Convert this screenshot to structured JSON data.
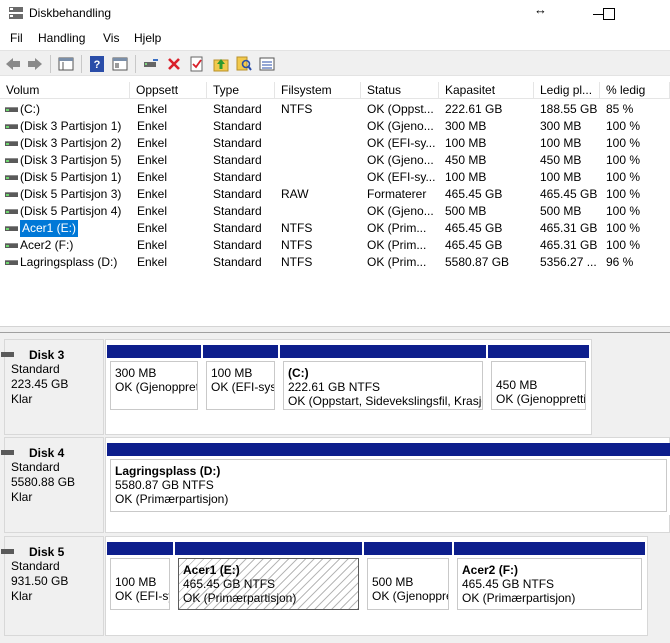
{
  "window": {
    "title": "Diskbehandling"
  },
  "menu": [
    "Fil",
    "Handling",
    "Vis",
    "Hjelp"
  ],
  "toolbar": {
    "icons": [
      "back-icon",
      "forward-icon",
      "properties-pane-icon",
      "help-icon",
      "console-icon",
      "connect-icon",
      "delete-icon",
      "check-icon",
      "folder-up-icon",
      "search-icon",
      "list-view-icon"
    ]
  },
  "colors": {
    "partition_bar": "#0d1e8c",
    "selection": "#0078d7"
  },
  "volume_list": {
    "headers": [
      "Volum",
      "Oppsett",
      "Type",
      "Filsystem",
      "Status",
      "Kapasitet",
      "Ledig pl...",
      "% ledig"
    ],
    "rows": [
      [
        "(C:)",
        "Enkel",
        "Standard",
        "NTFS",
        "OK (Oppst...",
        "222.61 GB",
        "188.55 GB",
        "85 %"
      ],
      [
        "(Disk 3 Partisjon 1)",
        "Enkel",
        "Standard",
        "",
        "OK (Gjeno...",
        "300 MB",
        "300 MB",
        "100 %"
      ],
      [
        "(Disk 3 Partisjon 2)",
        "Enkel",
        "Standard",
        "",
        "OK (EFI-sy...",
        "100 MB",
        "100 MB",
        "100 %"
      ],
      [
        "(Disk 3 Partisjon 5)",
        "Enkel",
        "Standard",
        "",
        "OK (Gjeno...",
        "450 MB",
        "450 MB",
        "100 %"
      ],
      [
        "(Disk 5 Partisjon 1)",
        "Enkel",
        "Standard",
        "",
        "OK (EFI-sy...",
        "100 MB",
        "100 MB",
        "100 %"
      ],
      [
        "(Disk 5 Partisjon 3)",
        "Enkel",
        "Standard",
        "RAW",
        "Formaterer",
        "465.45 GB",
        "465.45 GB",
        "100 %"
      ],
      [
        "(Disk 5 Partisjon 4)",
        "Enkel",
        "Standard",
        "",
        "OK (Gjeno...",
        "500 MB",
        "500 MB",
        "100 %"
      ],
      [
        "Acer1 (E:)",
        "Enkel",
        "Standard",
        "NTFS",
        "OK (Prim...",
        "465.45 GB",
        "465.31 GB",
        "100 %"
      ],
      [
        "Acer2 (F:)",
        "Enkel",
        "Standard",
        "NTFS",
        "OK (Prim...",
        "465.45 GB",
        "465.31 GB",
        "100 %"
      ],
      [
        "Lagringsplass (D:)",
        "Enkel",
        "Standard",
        "NTFS",
        "OK (Prim...",
        "5580.87 GB",
        "5356.27 ...",
        "96 %"
      ]
    ]
  },
  "disks": [
    {
      "name": "Disk 3",
      "type": "Standard",
      "size": "223.45 GB",
      "state": "Klar",
      "partitions": [
        {
          "title": "",
          "size": "300 MB",
          "status": "OK (Gjenopprettingspartisjon)",
          "hatched": false
        },
        {
          "title": "",
          "size": "100 MB",
          "status": "OK (EFI-systempartisjon)",
          "hatched": false
        },
        {
          "title": "(C:)",
          "size": "222.61 GB NTFS",
          "status": "OK (Oppstart, Sidevekslingsfil, Krasjdump, Primærpartisjon)",
          "hatched": false
        },
        {
          "title": "",
          "size": "450 MB",
          "status": "OK (Gjenopprettingspartisjon)",
          "hatched": false
        }
      ]
    },
    {
      "name": "Disk 4",
      "type": "Standard",
      "size": "5580.88 GB",
      "state": "Klar",
      "partitions": [
        {
          "title": "Lagringsplass  (D:)",
          "size": "5580.87 GB NTFS",
          "status": "OK (Primærpartisjon)",
          "hatched": false
        }
      ]
    },
    {
      "name": "Disk 5",
      "type": "Standard",
      "size": "931.50 GB",
      "state": "Klar",
      "partitions": [
        {
          "title": "",
          "size": "100 MB",
          "status": "OK (EFI-systempartisjon)",
          "hatched": false
        },
        {
          "title": "Acer1  (E:)",
          "size": "465.45 GB NTFS",
          "status": "OK (Primærpartisjon)",
          "hatched": true
        },
        {
          "title": "",
          "size": "500 MB",
          "status": "OK (Gjenopprettingspartisjon)",
          "hatched": false
        },
        {
          "title": "Acer2  (F:)",
          "size": "465.45 GB NTFS",
          "status": "OK (Primærpartisjon)",
          "hatched": false
        }
      ]
    }
  ]
}
